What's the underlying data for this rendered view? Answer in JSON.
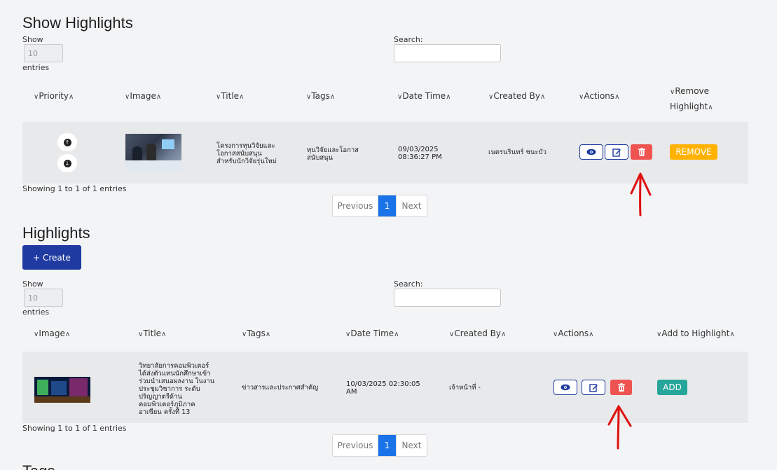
{
  "show_highlights": {
    "title": "Show Highlights",
    "show_label": "Show",
    "length_value": "10",
    "entries_label": "entries",
    "search_label": "Search:",
    "columns": [
      "Priority",
      "Image",
      "Title",
      "Tags",
      "Date Time",
      "Created By",
      "Actions",
      "Remove",
      "Highlight"
    ],
    "row": {
      "title": "โครงการทุนวิจัยและโอกาสสนับสนุนสำหรับนักวิจัยรุ่นใหม่",
      "tags": "ทุนวิจัยและโอกาสสนับสนุน",
      "date": "09/03/2025",
      "time": "08:36:27 PM",
      "created_by": "เนตรนรินทร์ ชนะบัว",
      "remove_label": "REMOVE"
    },
    "info": "Showing 1 to 1 of 1 entries",
    "pager": {
      "previous": "Previous",
      "page": "1",
      "next": "Next"
    }
  },
  "highlights": {
    "title": "Highlights",
    "create_label": "+ Create",
    "show_label": "Show",
    "length_value": "10",
    "entries_label": "entries",
    "search_label": "Search:",
    "columns": [
      "Image",
      "Title",
      "Tags",
      "Date Time",
      "Created By",
      "Actions",
      "Add to Highlight"
    ],
    "row": {
      "title": "วิทยาลัยการคอมพิวเตอร์ ได้ส่งตัวแทนนักศึกษาเข้าร่วมนำเสนอผลงาน ในงานประชุมวิชาการ ระดับปริญญาตรีด้านคอมพิวเตอร์ภูมิภาคอาเซียน ครั้งที่ 13",
      "tags": "ข่าวสารและประกาศสำคัญ",
      "datetime": "10/03/2025 02:30:05 AM",
      "created_by": "เจ้าหน้าที่ -",
      "add_label": "ADD"
    },
    "info": "Showing 1 to 1 of 1 entries",
    "pager": {
      "previous": "Previous",
      "page": "1",
      "next": "Next"
    }
  },
  "next_section_title": "Tags",
  "colors": {
    "accent": "#1f3aa0",
    "delete": "#ef5350",
    "remove": "#ffb300",
    "add": "#26a69a",
    "annotation": "#e01010",
    "page_active": "#1a73e8"
  }
}
